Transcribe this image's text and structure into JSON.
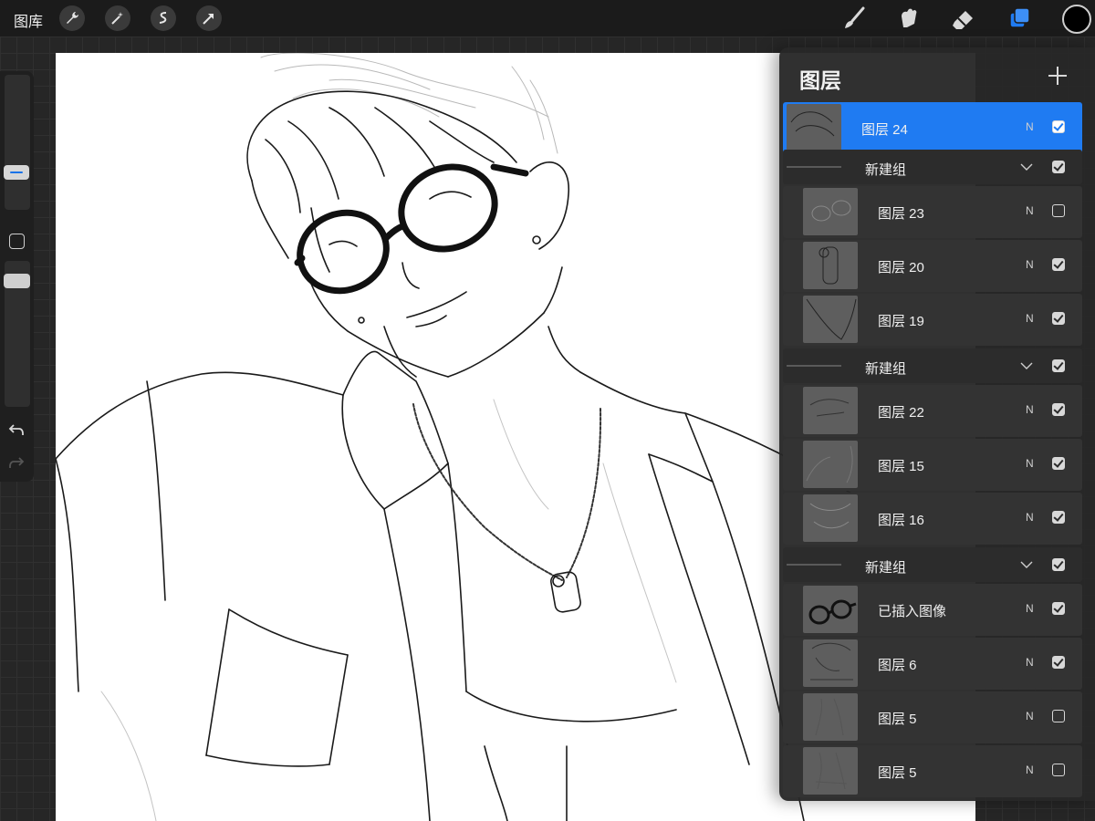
{
  "topbar": {
    "gallery_label": "图库",
    "left_tools": [
      "wrench-icon",
      "magic-wand-icon",
      "selection-icon",
      "transform-icon"
    ],
    "right_tools": [
      "brush-icon",
      "smudge-icon",
      "eraser-icon",
      "layers-icon"
    ],
    "active_tool": "layers-icon",
    "current_color": "#000000"
  },
  "sidebar": {
    "tools": [
      "brush-size-slider",
      "modify-button",
      "opacity-slider",
      "undo-icon",
      "redo-icon"
    ]
  },
  "canvas": {
    "artwork": "line-art drawing of a young man wearing round black glasses, an open collared shirt and a chain necklace with a tag"
  },
  "layers_panel": {
    "title": "图层",
    "add_icon": "plus-icon",
    "rows": [
      {
        "type": "layer",
        "name": "图层 24",
        "blend": "N",
        "visible": true,
        "selected": true
      },
      {
        "type": "group",
        "name": "新建组",
        "visible": true
      },
      {
        "type": "layer",
        "name": "图层 23",
        "blend": "N",
        "visible": false,
        "indent": true
      },
      {
        "type": "layer",
        "name": "图层 20",
        "blend": "N",
        "visible": true,
        "indent": true
      },
      {
        "type": "layer",
        "name": "图层 19",
        "blend": "N",
        "visible": true,
        "indent": true
      },
      {
        "type": "group",
        "name": "新建组",
        "visible": true
      },
      {
        "type": "layer",
        "name": "图层 22",
        "blend": "N",
        "visible": true,
        "indent": true
      },
      {
        "type": "layer",
        "name": "图层 15",
        "blend": "N",
        "visible": true,
        "indent": true
      },
      {
        "type": "layer",
        "name": "图层 16",
        "blend": "N",
        "visible": true,
        "indent": true
      },
      {
        "type": "group",
        "name": "新建组",
        "visible": true
      },
      {
        "type": "layer",
        "name": "已插入图像",
        "blend": "N",
        "visible": true,
        "indent": true
      },
      {
        "type": "layer",
        "name": "图层 6",
        "blend": "N",
        "visible": true,
        "indent": true
      },
      {
        "type": "layer",
        "name": "图层 5",
        "blend": "N",
        "visible": false,
        "indent": true
      },
      {
        "type": "layer",
        "name": "图层 5",
        "blend": "N",
        "visible": false,
        "indent": true
      }
    ]
  },
  "colors": {
    "accent": "#1f7bf2",
    "toolbar_bg": "#1b1b1b",
    "panel_bg": "#282828"
  }
}
